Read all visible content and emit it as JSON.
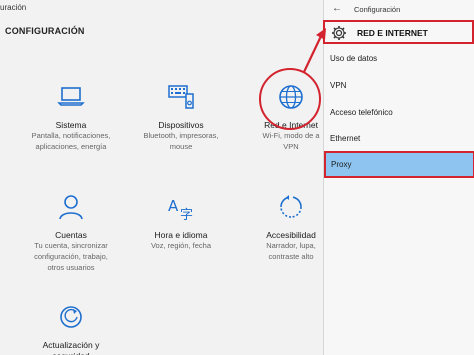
{
  "window": {
    "title": "uración"
  },
  "main": {
    "heading": "CONFIGURACIÓN",
    "tiles": [
      {
        "icon": "laptop-icon",
        "name": "Sistema",
        "desc": [
          "Pantalla, notificaciones,",
          "aplicaciones, energía"
        ]
      },
      {
        "icon": "devices-icon",
        "name": "Dispositivos",
        "desc": [
          "Bluetooth, impresoras,",
          "mouse"
        ]
      },
      {
        "icon": "globe-icon",
        "name": "Red e Internet",
        "desc": [
          "Wi-Fi, modo de a",
          "VPN"
        ]
      },
      {
        "icon": "person-icon",
        "name": "Cuentas",
        "desc": [
          "Tu cuenta, sincronizar",
          "configuración, trabajo,",
          "otros usuarios"
        ]
      },
      {
        "icon": "language-icon",
        "name": "Hora e idioma",
        "desc": [
          "Voz, región, fecha"
        ]
      },
      {
        "icon": "accessibility-icon",
        "name": "Accesibilidad",
        "desc": [
          "Narrador, lupa,",
          "contraste alto"
        ]
      },
      {
        "icon": "shield-icon",
        "name": "Actualización y",
        "desc": [
          "seguridad"
        ]
      }
    ]
  },
  "panel": {
    "title": "Configuración",
    "heading": "RED E INTERNET",
    "items": [
      "Uso de datos",
      "VPN",
      "Acceso telefónico",
      "Ethernet",
      "Proxy"
    ]
  },
  "colors": {
    "accent": "#1e6fcf",
    "annotation": "#d3232e",
    "selected": "#8ec5f0"
  }
}
